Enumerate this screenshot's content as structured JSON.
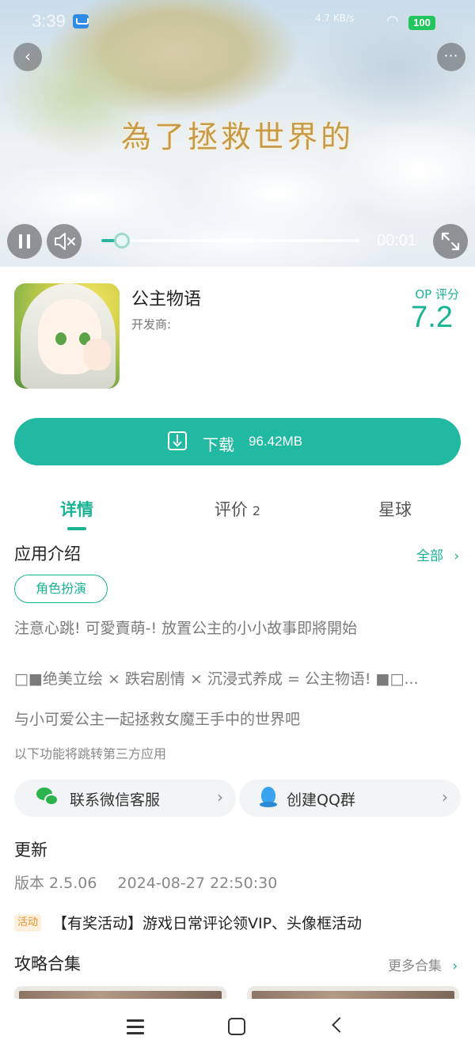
{
  "status_bar": {
    "time": "3:39",
    "network": "4.7 KB/s",
    "battery": "100"
  },
  "video": {
    "overlay_title": "為了拯救世界的",
    "time": "00:01",
    "progress": 0.08,
    "back_icon": "chevron-left-icon",
    "more_icon": "ellipsis-icon",
    "pause_icon": "pause-icon",
    "mute_icon": "mute-icon",
    "fullscreen_icon": "expand-icon"
  },
  "app": {
    "name": "公主物语",
    "developer_label": "开发商:",
    "rating_label": "OP 评分",
    "rating": "7.2",
    "accent_color": "#1ab394"
  },
  "download": {
    "label": "下载",
    "size": "96.42MB"
  },
  "tabs": [
    {
      "label": "详情",
      "active": true
    },
    {
      "label": "评价",
      "count": "2",
      "active": false
    },
    {
      "label": "星球",
      "active": false
    }
  ],
  "intro": {
    "title": "应用介绍",
    "see_all": "全部",
    "tag": "角色扮演",
    "lines": [
      "注意心跳! 可愛賣萌-! 放置公主的小小故事即將開始",
      "□■绝美立绘 × 跌宕剧情 × 沉浸式养成 = 公主物语! ■□...",
      "与小可爱公主一起拯救女魔王手中的世界吧"
    ],
    "third_party_note": "以下功能将跳转第三方应用"
  },
  "contacts": [
    {
      "label": "联系微信客服",
      "icon": "wechat-icon"
    },
    {
      "label": "创建QQ群",
      "icon": "qq-icon"
    }
  ],
  "update": {
    "title": "更新",
    "version": "版本 2.5.06",
    "date": "2024-08-27 22:50:30",
    "event_badge": "活动",
    "event_text": "【有奖活动】游戏日常评论领VIP、头像框活动"
  },
  "guides": {
    "title": "攻略合集",
    "more": "更多合集"
  },
  "nav": {
    "menu_icon": "menu-icon",
    "home_icon": "home-icon",
    "back_icon": "back-icon"
  }
}
